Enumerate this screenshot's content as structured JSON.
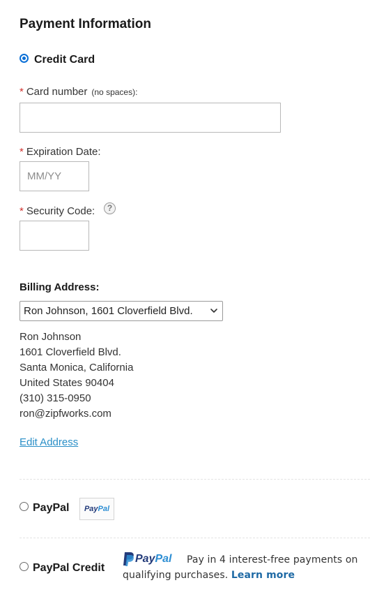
{
  "section_title": "Payment Information",
  "credit_card": {
    "option_label": "Credit Card",
    "selected": true,
    "card_number": {
      "required_mark": "*",
      "label": "Card number",
      "hint": "(no spaces):",
      "value": "",
      "placeholder": ""
    },
    "expiration": {
      "required_mark": "*",
      "label": "Expiration Date:",
      "value": "",
      "placeholder": "MM/YY"
    },
    "security_code": {
      "required_mark": "*",
      "label": "Security Code:",
      "help_glyph": "?",
      "value": "",
      "placeholder": ""
    }
  },
  "billing": {
    "title": "Billing Address:",
    "selected_address": "Ron Johnson, 1601 Cloverfield Blvd.",
    "address_lines": [
      "Ron Johnson",
      "1601 Cloverfield Blvd.",
      "Santa Monica, California",
      "United States 90404",
      "(310) 315-0950",
      "ron@zipfworks.com"
    ],
    "edit_link": "Edit Address"
  },
  "paypal": {
    "option_label": "PayPal",
    "selected": false,
    "badge_dark": "Pay",
    "badge_light": "Pal"
  },
  "paypal_credit": {
    "option_label": "PayPal Credit",
    "selected": false,
    "logo_dark": "Pay",
    "logo_light": "Pal",
    "message_line1": "Pay in 4 interest-free payments on",
    "message_line2": "qualifying purchases.",
    "learn_more": "Learn more"
  },
  "colors": {
    "accent_radio": "#0a6fd6",
    "required": "#d0312d",
    "link": "#2a8fc7",
    "paypal_dark": "#233b7a",
    "paypal_light": "#2d8ed3"
  },
  "icons": {
    "help": "question-circle-icon",
    "dropdown": "chevron-down-icon",
    "paypal_logo": "paypal-p-icon"
  }
}
